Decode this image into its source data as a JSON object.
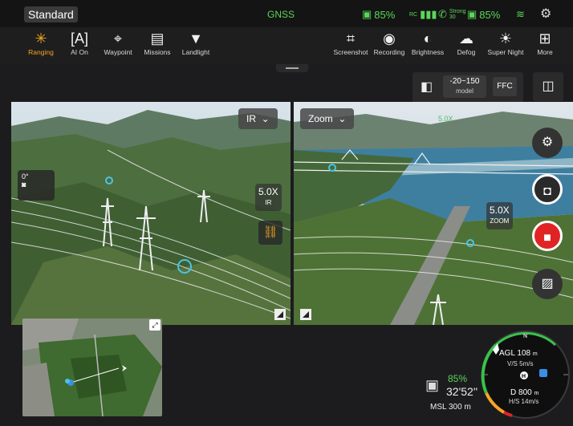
{
  "status": {
    "mode": "Standard",
    "gnss": "GNSS",
    "rc_battery": "85%",
    "signal_label": "RC",
    "sat_label_top": "Strong",
    "sat_label_bottom": "30",
    "aircraft_battery": "85%"
  },
  "toolbar_left": [
    {
      "icon": "ranging-icon",
      "glyph": "✳",
      "label": "Ranging",
      "active": true
    },
    {
      "icon": "ai-icon",
      "glyph": "[A]",
      "label": "AI On",
      "active": false
    },
    {
      "icon": "waypoint-icon",
      "glyph": "⌖",
      "label": "Waypoint",
      "active": false
    },
    {
      "icon": "missions-icon",
      "glyph": "▤",
      "label": "Missions",
      "active": false
    },
    {
      "icon": "landlight-icon",
      "glyph": "▼",
      "label": "Landlight",
      "active": false
    }
  ],
  "toolbar_right": [
    {
      "icon": "screenshot-icon",
      "glyph": "⌗",
      "label": "Screenshot"
    },
    {
      "icon": "recording-icon",
      "glyph": "◉",
      "label": "Recording"
    },
    {
      "icon": "brightness-icon",
      "glyph": "◐",
      "label": "Brightness"
    },
    {
      "icon": "defog-icon",
      "glyph": "☁",
      "label": "Defog"
    },
    {
      "icon": "super-night-icon",
      "glyph": "☀",
      "label": "Super Night"
    },
    {
      "icon": "more-icon",
      "glyph": "⊞",
      "label": "More"
    }
  ],
  "subbar": {
    "range_top": "-20~150",
    "range_bottom": "model",
    "ffc": "FFC"
  },
  "ir_view": {
    "dropdown": "IR",
    "zoom_value": "5.0X",
    "zoom_mode": "IR",
    "gimbal_angle": "0°"
  },
  "zoom_view": {
    "dropdown": "Zoom",
    "zoom_value": "5.0X",
    "zoom_mode": "ZOOM",
    "overlay_zoom": "5.0X"
  },
  "telemetry": {
    "battery": "85%",
    "flight_time": "32'52''",
    "msl_label": "MSL",
    "msl_value": "300 m",
    "agl_label": "AGL",
    "agl_value": "108",
    "agl_unit": "m",
    "vs": "V/S 5m/s",
    "distance_label": "D",
    "distance_value": "800",
    "distance_unit": "m",
    "hs": "H/S 14m/s",
    "north": "N",
    "home": "H"
  },
  "colors": {
    "accent": "#f5a623",
    "status_green": "#5ad65a",
    "record_red": "#e02424"
  }
}
